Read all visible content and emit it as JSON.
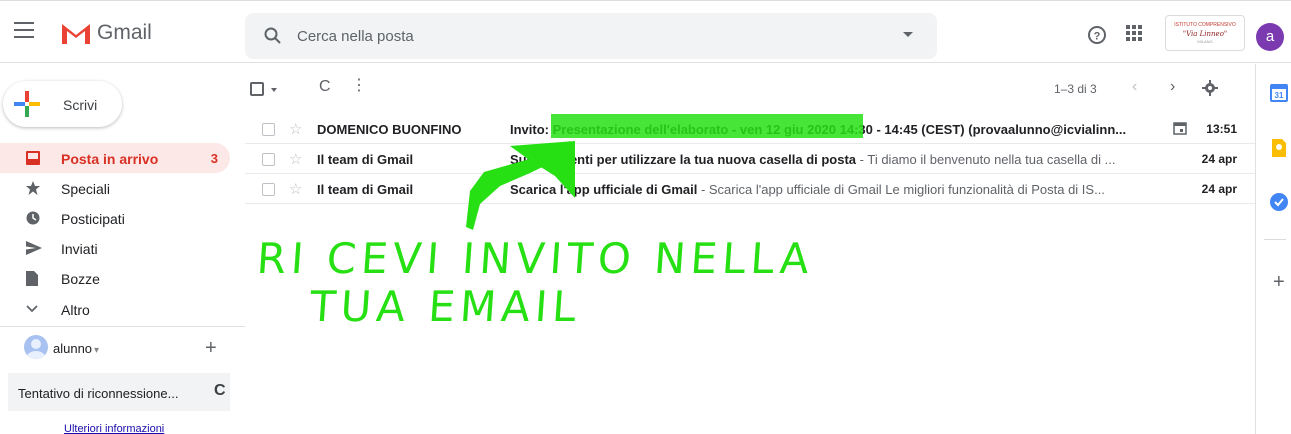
{
  "header": {
    "app_name": "Gmail",
    "search_placeholder": "Cerca nella posta",
    "org_logo_line1": "ISTITUTO COMPRENSIVO",
    "org_logo_line2": "\"Via Linneo\"",
    "org_logo_line3": "MILANO",
    "account_initial": "a"
  },
  "sidebar": {
    "compose_label": "Scrivi",
    "items": [
      {
        "label": "Posta in arrivo",
        "count": "3",
        "icon": "inbox-icon"
      },
      {
        "label": "Speciali",
        "icon": "star-icon"
      },
      {
        "label": "Posticipati",
        "icon": "clock-icon"
      },
      {
        "label": "Inviati",
        "icon": "send-icon"
      },
      {
        "label": "Bozze",
        "icon": "draft-icon"
      },
      {
        "label": "Altro",
        "icon": "chevron-down-icon"
      }
    ],
    "user_name": "alunno",
    "reconnect_text": "Tentativo di riconnessione...",
    "more_info_link": "Ulteriori informazioni"
  },
  "toolbar": {
    "pager_text": "1–3 di 3"
  },
  "emails": [
    {
      "sender": "DOMENICO BUONFINO",
      "subject": "Invito: Presentazione dell'elaborato - ven 12 giu 2020 14:30 - 14:45 (CEST) (provaalunno@icvialinn...",
      "snippet": "",
      "date": "13:51",
      "has_calendar": true
    },
    {
      "sender": "Il team di Gmail",
      "subject": "Suggerimenti per utilizzare la tua nuova casella di posta",
      "snippet": " - Ti diamo il benvenuto nella tua casella di ...",
      "date": "24 apr",
      "has_calendar": false
    },
    {
      "sender": "Il team di Gmail",
      "subject": "Scarica l'app ufficiale di Gmail",
      "snippet": " - Scarica l'app ufficiale di Gmail Le migliori funzionalità di Posta di IS...",
      "date": "24 apr",
      "has_calendar": false
    }
  ],
  "annotation": {
    "line1": "RI CEVI INVITO NELLA",
    "line2": "TUA EMAIL",
    "color": "#27e014"
  },
  "colors": {
    "accent_red": "#d93025",
    "highlight_green": "#27e014"
  }
}
